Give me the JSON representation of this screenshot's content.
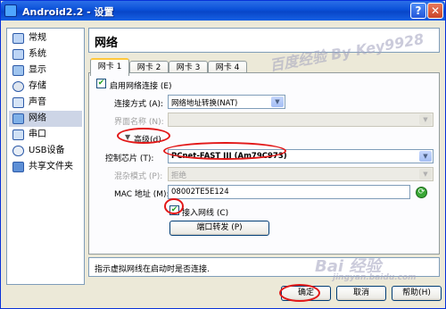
{
  "window": {
    "title": "Android2.2 - 设置",
    "help_glyph": "?",
    "close_glyph": "✕"
  },
  "sidebar": {
    "items": [
      {
        "label": "常规",
        "icon": "general-icon"
      },
      {
        "label": "系统",
        "icon": "system-icon"
      },
      {
        "label": "显示",
        "icon": "display-icon"
      },
      {
        "label": "存储",
        "icon": "storage-icon"
      },
      {
        "label": "声音",
        "icon": "audio-icon"
      },
      {
        "label": "网络",
        "icon": "network-icon",
        "selected": true
      },
      {
        "label": "串口",
        "icon": "serial-port-icon"
      },
      {
        "label": "USB设备",
        "icon": "usb-icon"
      },
      {
        "label": "共享文件夹",
        "icon": "shared-folder-icon"
      }
    ]
  },
  "section": {
    "title": "网络"
  },
  "tabs": [
    "网卡 1",
    "网卡 2",
    "网卡 3",
    "网卡 4"
  ],
  "adapter": {
    "enable_label": "启用网络连接 (E)",
    "enable_checked": "✔",
    "attached_label": "连接方式 (A):",
    "attached_value": "网络地址转换(NAT)",
    "name_label": "界面名称 (N):",
    "name_value": "",
    "advanced_arrow": "▼",
    "advanced_label": "高级(d)",
    "type_label": "控制芯片 (T):",
    "type_value": "PCnet-FAST III (Am79C973)",
    "promisc_label": "混杂模式 (P):",
    "promisc_value": "拒绝",
    "mac_label": "MAC 地址 (M):",
    "mac_value": "08002TE5E124",
    "cable_label": "接入网线 (C)",
    "cable_checked": "✔",
    "refresh_glyph": "⟳",
    "port_forward_label": "端口转发 (P)",
    "dropdown_glyph": "▼"
  },
  "hint": {
    "text": "指示虚拟网线在启动时是否连接."
  },
  "footer": {
    "ok_label": "确定",
    "cancel_label": "取消",
    "help_label": "帮助(H)"
  },
  "watermarks": {
    "top": "百度经验 By Key9928",
    "bottom": "Bai 经验",
    "bottom_sub": "jingyan.baidu.com"
  }
}
